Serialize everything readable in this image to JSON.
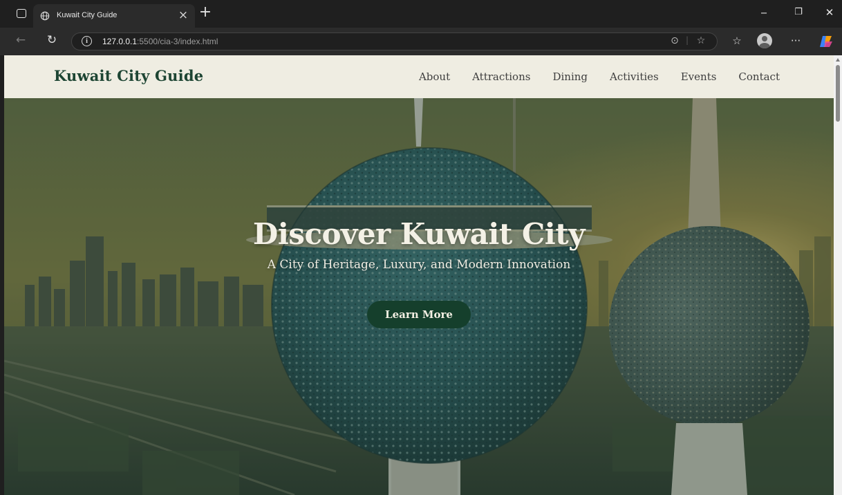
{
  "browser": {
    "tab_title": "Kuwait City Guide",
    "tab_close": "×",
    "new_tab": "+",
    "url_host": "127.0.0.1",
    "url_rest": ":5500/cia-3/index.html",
    "controls": {
      "minimize": "‒",
      "restore": "❐",
      "close": "✕"
    },
    "icons": [
      "tab-actions-icon",
      "globe-icon",
      "back-icon",
      "reload-icon",
      "site-info-icon",
      "reading-mode-icon",
      "favorite-star-icon",
      "favorites-icon",
      "profile-icon",
      "more-icon",
      "copilot-icon"
    ]
  },
  "site": {
    "logo": "Kuwait City Guide",
    "nav": [
      "About",
      "Attractions",
      "Dining",
      "Activities",
      "Events",
      "Contact"
    ],
    "hero": {
      "title": "Discover Kuwait City",
      "subtitle": "A City of Heritage, Luxury, and Modern Innovation",
      "button": "Learn More"
    }
  },
  "colors": {
    "header_bg": "#efede2",
    "brand_green": "#1d4533",
    "button_green": "#153f2c",
    "hero_overlay": "#1f3a30"
  }
}
